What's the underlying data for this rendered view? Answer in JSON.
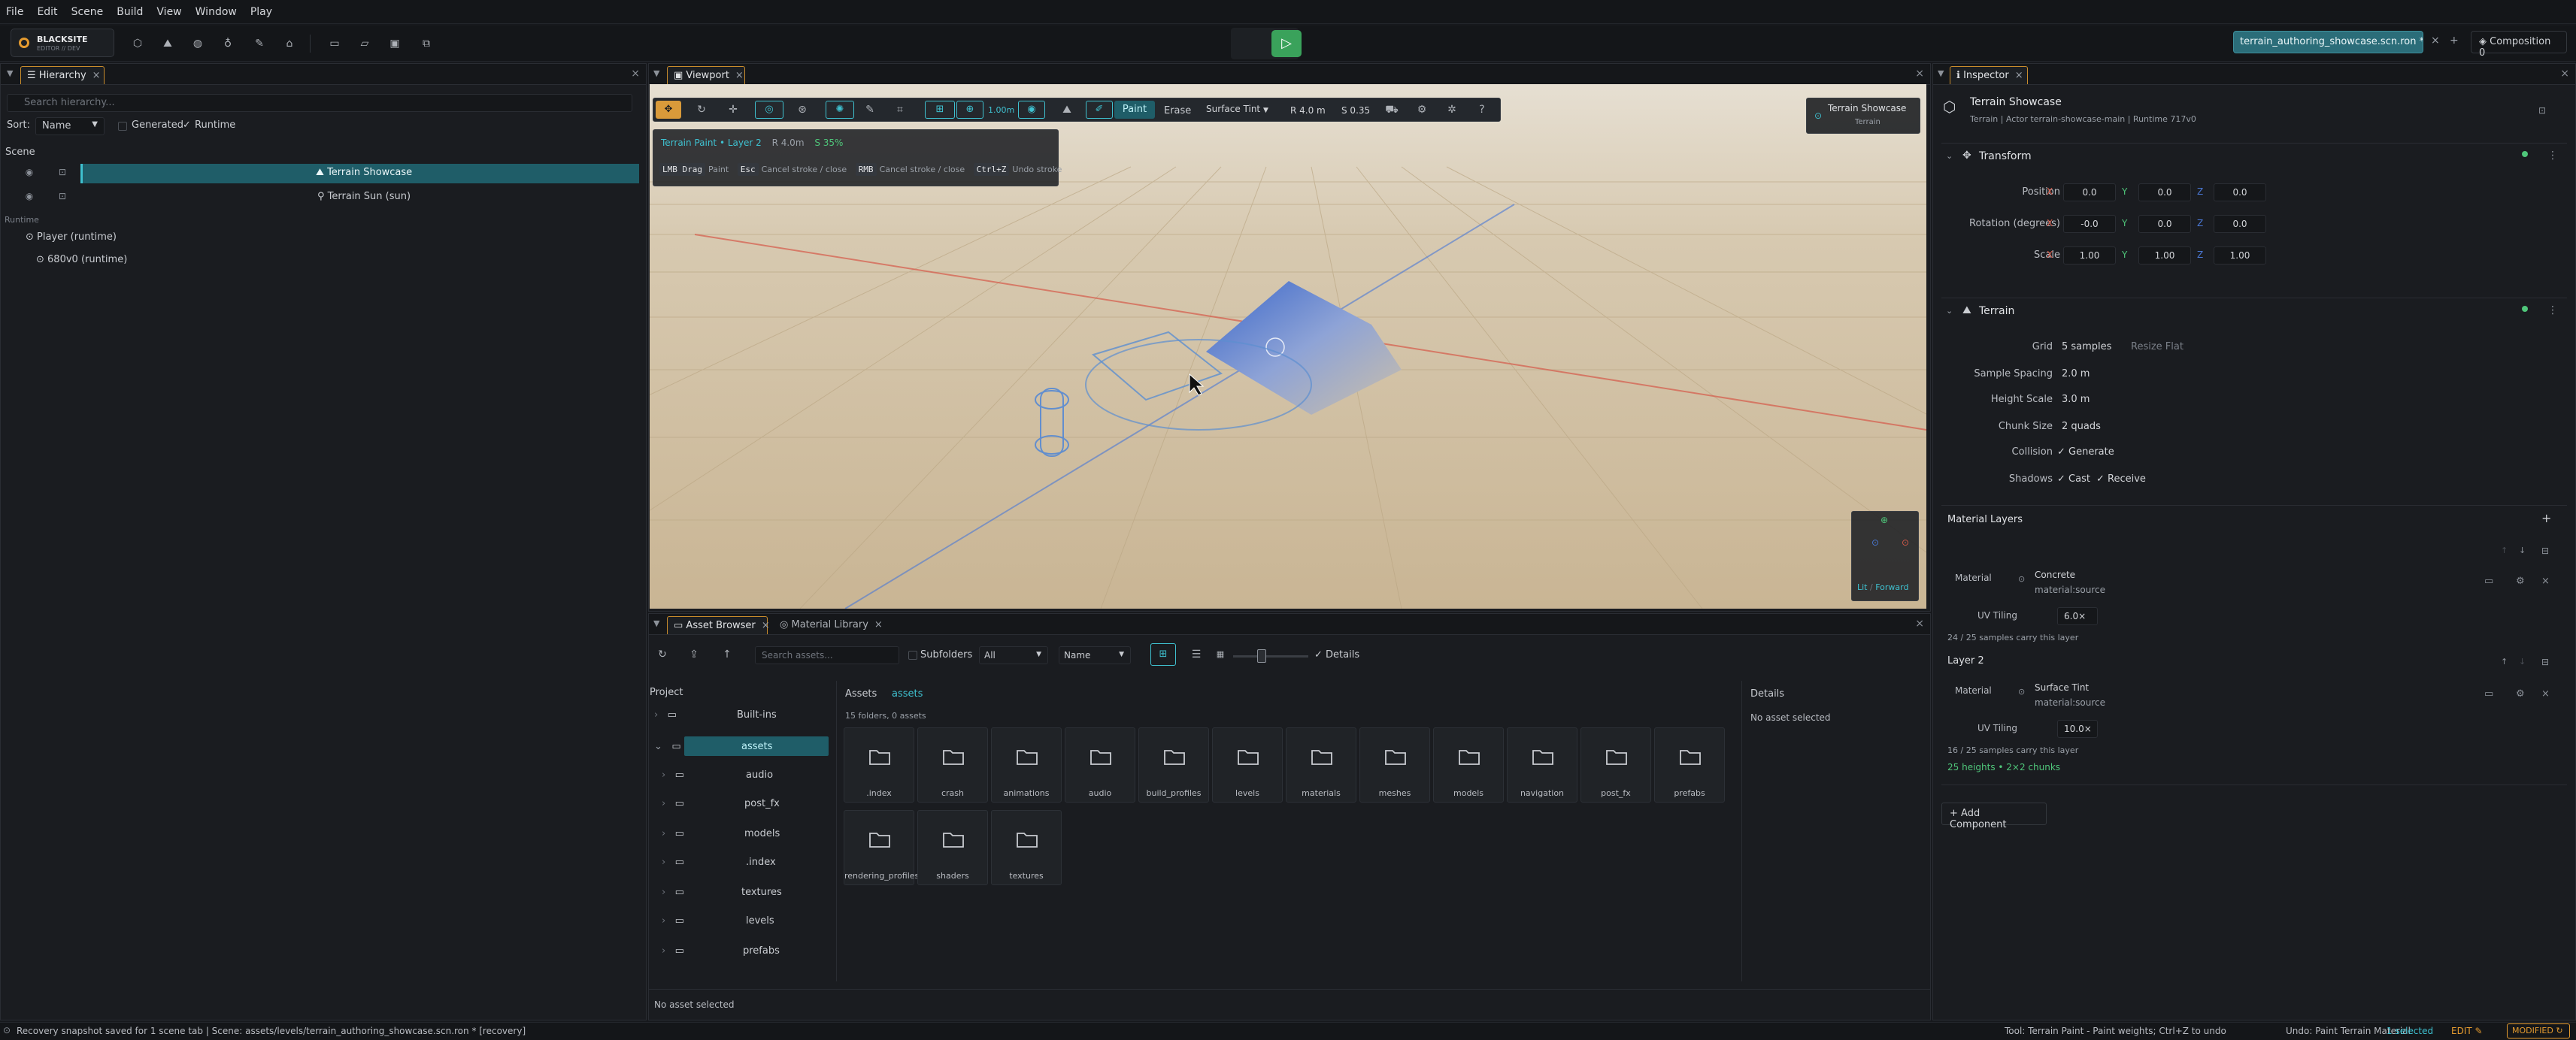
{
  "menu": [
    "File",
    "Edit",
    "Scene",
    "Build",
    "View",
    "Window",
    "Play"
  ],
  "app": {
    "name": "BLACKSITE",
    "subtitle": "EDITOR // DEV"
  },
  "scene_tab": {
    "label": "terrain_authoring_showcase.scn.ron *",
    "close": "×",
    "add": "+"
  },
  "composition": "Composition 0",
  "hierarchy": {
    "tab": "Hierarchy",
    "search_placeholder": "Search hierarchy...",
    "sort_label": "Sort:",
    "sort_value": "Name",
    "generated": "Generated",
    "runtime": "Runtime",
    "scene_header": "Scene",
    "items": [
      {
        "label": "Terrain Showcase"
      },
      {
        "label": "Terrain Sun  (sun)"
      }
    ],
    "runtime_header": "Runtime",
    "runtime_items": [
      {
        "label": "Player  (runtime)"
      },
      {
        "label": "680v0  (runtime)"
      }
    ]
  },
  "viewport": {
    "tab": "Viewport",
    "grid_size": "1.00m",
    "paint": "Paint",
    "erase": "Erase",
    "layer_select": "Surface Tint",
    "radius": "R 4.0 m",
    "strength": "S 0.35",
    "info_title": "Terrain Paint • Layer 2",
    "info_radius": "R 4.0m",
    "info_strength": "S 35%",
    "hints": [
      {
        "key": "LMB Drag",
        "text": "Paint"
      },
      {
        "key": "Esc",
        "text": "Cancel stroke / close"
      },
      {
        "key": "RMB",
        "text": "Cancel stroke / close"
      },
      {
        "key": "Ctrl+Z",
        "text": "Undo stroke"
      }
    ],
    "overlay_title": "Terrain Showcase",
    "overlay_sub": "Terrain",
    "gizmo_lit": "Lit",
    "gizmo_forward": "Forward"
  },
  "inspector": {
    "tab": "Inspector",
    "entity_name": "Terrain Showcase",
    "entity_sub": "Terrain  |  Actor terrain-showcase-main  |  Runtime 717v0",
    "transform": {
      "title": "Transform",
      "rows": [
        {
          "label": "Position",
          "x": "0.0",
          "y": "0.0",
          "z": "0.0"
        },
        {
          "label": "Rotation (degrees)",
          "x": "-0.0",
          "y": "0.0",
          "z": "0.0"
        },
        {
          "label": "Scale",
          "x": "1.00",
          "y": "1.00",
          "z": "1.00"
        }
      ]
    },
    "terrain": {
      "title": "Terrain",
      "grid_label": "Grid",
      "grid_value": "5 samples",
      "resize_flat": "Resize Flat",
      "sample_spacing_label": "Sample Spacing",
      "sample_spacing": "2.0 m",
      "height_scale_label": "Height Scale",
      "height_scale": "3.0 m",
      "chunk_size_label": "Chunk Size",
      "chunk_size": "2 quads",
      "collision_label": "Collision",
      "collision_value": "Generate",
      "shadows_label": "Shadows",
      "shadows_cast": "Cast",
      "shadows_receive": "Receive"
    },
    "material_layers": {
      "title": "Material Layers",
      "layer1": {
        "material_label": "Material",
        "material_name": "Concrete",
        "material_source": "material:source",
        "uv_label": "UV Tiling",
        "uv_value": "6.0×",
        "note": "24 / 25 samples carry this layer"
      },
      "layer2": {
        "title": "Layer 2",
        "material_label": "Material",
        "material_name": "Surface Tint",
        "material_source": "material:source",
        "uv_label": "UV Tiling",
        "uv_value": "10.0×",
        "note": "16 / 25 samples carry this layer",
        "summary": "25 heights • 2×2 chunks"
      }
    },
    "add_component": "+ Add Component"
  },
  "assets": {
    "tab_browser": "Asset Browser",
    "tab_library": "Material Library",
    "search_placeholder": "Search assets...",
    "subfolders": "Subfolders",
    "filter": "All",
    "sort": "Name",
    "details_toggle": "Details",
    "project_label": "Project",
    "tree": [
      "Built-ins",
      "assets",
      "audio",
      "post_fx",
      "models",
      ".index",
      "textures",
      "levels",
      "prefabs"
    ],
    "breadcrumb_root": "Assets",
    "breadcrumb_current": "assets",
    "count": "15 folders, 0 assets",
    "folders": [
      ".index",
      "crash",
      "animations",
      "audio",
      "build_profiles",
      "levels",
      "materials",
      "meshes",
      "models",
      "navigation",
      "post_fx",
      "prefabs",
      "rendering_profiles",
      "shaders",
      "textures"
    ],
    "details_title": "Details",
    "details_empty": "No asset selected",
    "footer": "No asset selected"
  },
  "status": {
    "left": "Recovery snapshot saved for 1 scene tab  |  Scene: assets/levels/terrain_authoring_showcase.scn.ron * [recovery]",
    "tool": "Tool: Terrain Paint - Paint weights; Ctrl+Z to undo",
    "undo": "Undo: Paint Terrain Material",
    "selected": "1 selected",
    "mode": "EDIT",
    "modified": "MODIFIED"
  },
  "colors": {
    "accent": "#3fc1d0",
    "tab_border": "#c98c2c",
    "play": "#3aa25b",
    "selection": "#1f5d68",
    "green_note": "#4fc67a"
  }
}
